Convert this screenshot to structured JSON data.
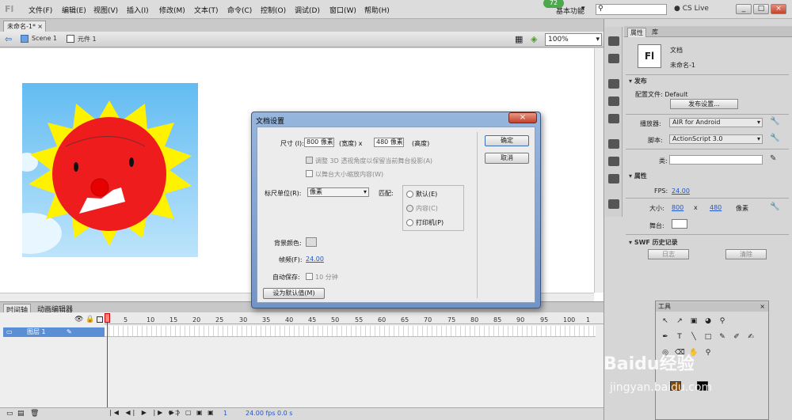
{
  "menubar": {
    "items": [
      "文件(F)",
      "编辑(E)",
      "视图(V)",
      "插入(I)",
      "修改(M)",
      "文本(T)",
      "命令(C)",
      "控制(O)",
      "调试(D)",
      "窗口(W)",
      "帮助(H)"
    ],
    "essentials_label": "基本功能",
    "badge": "72",
    "cs_live": "CS Live",
    "win_buttons": [
      "_",
      "□",
      "×"
    ]
  },
  "document": {
    "tab": "未命名-1*",
    "scene": "Scene 1",
    "symbol": "元件 1",
    "zoom": "100%"
  },
  "timeline": {
    "tabs": [
      "时间轴",
      "动画编辑器"
    ],
    "layer_name": "图层 1",
    "ruler": [
      "1",
      "5",
      "10",
      "15",
      "20",
      "25",
      "30",
      "35",
      "40",
      "45",
      "50",
      "55",
      "60",
      "65",
      "70",
      "75",
      "80",
      "85",
      "90",
      "95",
      "100",
      "1"
    ],
    "fps_readout": "24.00 fps",
    "time_readout": "0.0 s",
    "frame_readout": "1"
  },
  "properties": {
    "tabs": [
      "属性",
      "库"
    ],
    "fl_icon": "Fl",
    "doc_type": "文档",
    "doc_name": "未命名-1",
    "publish_section": "发布",
    "profile_label": "配置文件: Default",
    "publish_settings_button": "发布设置...",
    "player_label": "播放器:",
    "player_value": "AIR for Android",
    "script_label": "脚本:",
    "script_value": "ActionScript 3.0",
    "class_label": "类:",
    "properties_section": "属性",
    "fps_label": "FPS:",
    "fps_value": "24.00",
    "size_label": "大小:",
    "width": "800",
    "x": "x",
    "height": "480",
    "unit": "像素",
    "stage_label": "舞台:",
    "swf_section": "SWF 历史记录",
    "log_button": "日志",
    "clear_button": "清除"
  },
  "tools": {
    "title": "工具",
    "glyphs": [
      "↖",
      "↗",
      "▣",
      "◕",
      "⚲",
      "✒",
      "T",
      "╲",
      "□",
      "✎",
      "✐",
      "✍",
      "◎",
      "⌫",
      "✋",
      "⚲"
    ]
  },
  "dialog": {
    "title": "文档设置",
    "close_glyph": "×",
    "size_label": "尺寸 (I):",
    "width_value": "800 像素",
    "width_caption": "(宽度) x",
    "height_value": "480 像素",
    "height_caption": "(高度)",
    "adjust_3d": "调整 3D 透视角度以保留当前舞台投影(A)",
    "scale_content": "以舞台大小缩放内容(W)",
    "ruler_units_label": "标尺单位(R):",
    "ruler_units_value": "像素",
    "match_label": "匹配:",
    "match_default": "默认(E)",
    "match_contents": "内容(C)",
    "match_printer": "打印机(P)",
    "bg_color_label": "背景颜色:",
    "frame_rate_label": "帧频(F):",
    "frame_rate_value": "24.00",
    "autosave_label": "自动保存:",
    "autosave_minutes": "10 分钟",
    "set_default_button": "设为默认值(M)",
    "ok_button": "确定",
    "cancel_button": "取消"
  },
  "watermark": {
    "text": "Baidu经验",
    "url": "jingyan.baidu.com"
  },
  "colors": {
    "sky_top": "#62bcf2",
    "sun_face": "#ee1c1c",
    "sun_rays": "#fff200",
    "dialog_frame": "#7394c6",
    "layer_highlight": "#5a8fd6"
  }
}
